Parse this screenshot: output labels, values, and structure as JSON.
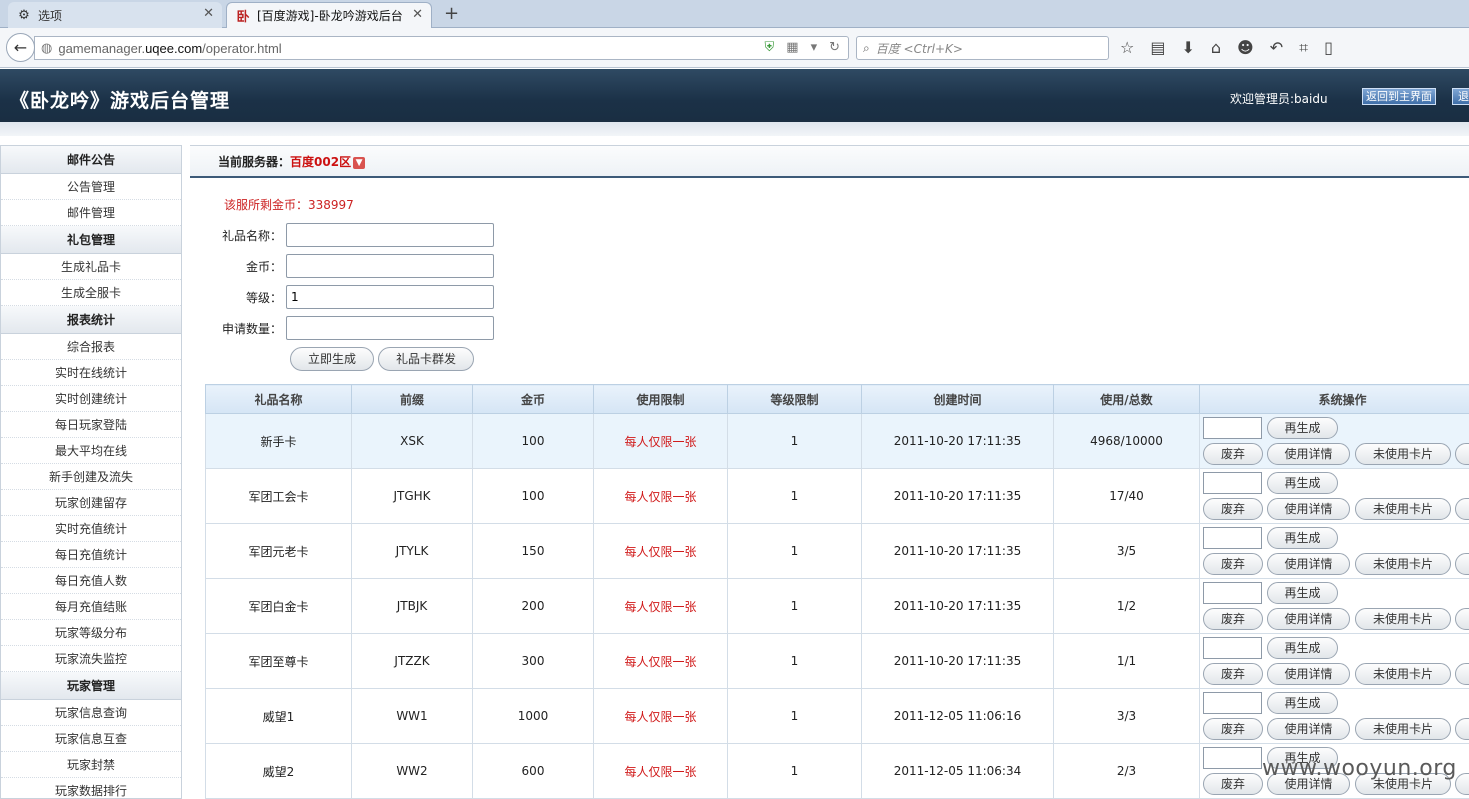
{
  "browser": {
    "tabs": [
      {
        "label": "选项",
        "icon": "gear-icon"
      },
      {
        "label": "[百度游戏]-卧龙吟游戏后台",
        "icon": "site-favicon"
      }
    ],
    "url_prefix": "gamemanager.",
    "url_domain": "uqee.com",
    "url_suffix": "/operator.html",
    "search_placeholder": "百度 <Ctrl+K>"
  },
  "header": {
    "title": "《卧龙吟》游戏后台管理",
    "welcome": "欢迎管理员:baidu",
    "home_button": "返回到主界面",
    "exit_button": "退出"
  },
  "sidebar": {
    "sections": [
      {
        "title": "邮件公告",
        "items": [
          "公告管理",
          "邮件管理"
        ]
      },
      {
        "title": "礼包管理",
        "items": [
          "生成礼品卡",
          "生成全服卡"
        ]
      },
      {
        "title": "报表统计",
        "items": [
          "综合报表",
          "实时在线统计",
          "实时创建统计",
          "每日玩家登陆",
          "最大平均在线",
          "新手创建及流失",
          "玩家创建留存",
          "实时充值统计",
          "每日充值统计",
          "每日充值人数",
          "每月充值结账",
          "玩家等级分布",
          "玩家流失监控"
        ]
      },
      {
        "title": "玩家管理",
        "items": [
          "玩家信息查询",
          "玩家信息互查",
          "玩家封禁",
          "玩家数据排行"
        ]
      }
    ]
  },
  "main": {
    "server_label": "当前服务器：",
    "server_name": "百度002区",
    "coins_text": "该服所剩金币：338997",
    "form": {
      "name_label": "礼品名称：",
      "name_value": "",
      "gold_label": "金币：",
      "gold_value": "",
      "level_label": "等级：",
      "level_value": "1",
      "count_label": "申请数量：",
      "count_value": ""
    },
    "generate_button": "立即生成",
    "mass_send_button": "礼品卡群发"
  },
  "table": {
    "headers": [
      "礼品名称",
      "前缀",
      "金币",
      "使用限制",
      "等级限制",
      "创建时间",
      "使用/总数",
      "系统操作"
    ],
    "rows": [
      {
        "name": "新手卡",
        "prefix": "XSK",
        "gold": "100",
        "limit": "每人仅限一张",
        "level": "1",
        "created": "2011-10-20 17:11:35",
        "usage": "4968/10000"
      },
      {
        "name": "军团工会卡",
        "prefix": "JTGHK",
        "gold": "100",
        "limit": "每人仅限一张",
        "level": "1",
        "created": "2011-10-20 17:11:35",
        "usage": "17/40"
      },
      {
        "name": "军团元老卡",
        "prefix": "JTYLK",
        "gold": "150",
        "limit": "每人仅限一张",
        "level": "1",
        "created": "2011-10-20 17:11:35",
        "usage": "3/5"
      },
      {
        "name": "军团白金卡",
        "prefix": "JTBJK",
        "gold": "200",
        "limit": "每人仅限一张",
        "level": "1",
        "created": "2011-10-20 17:11:35",
        "usage": "1/2"
      },
      {
        "name": "军团至尊卡",
        "prefix": "JTZZK",
        "gold": "300",
        "limit": "每人仅限一张",
        "level": "1",
        "created": "2011-10-20 17:11:35",
        "usage": "1/1"
      },
      {
        "name": "威望1",
        "prefix": "WW1",
        "gold": "1000",
        "limit": "每人仅限一张",
        "level": "1",
        "created": "2011-12-05 11:06:16",
        "usage": "3/3"
      },
      {
        "name": "威望2",
        "prefix": "WW2",
        "gold": "600",
        "limit": "每人仅限一张",
        "level": "1",
        "created": "2011-12-05 11:06:34",
        "usage": "2/3"
      }
    ],
    "ops": {
      "regen": "再生成",
      "void": "废弃",
      "detail": "使用详情",
      "unused": "未使用卡片"
    }
  },
  "watermark": "www.wooyun.org"
}
